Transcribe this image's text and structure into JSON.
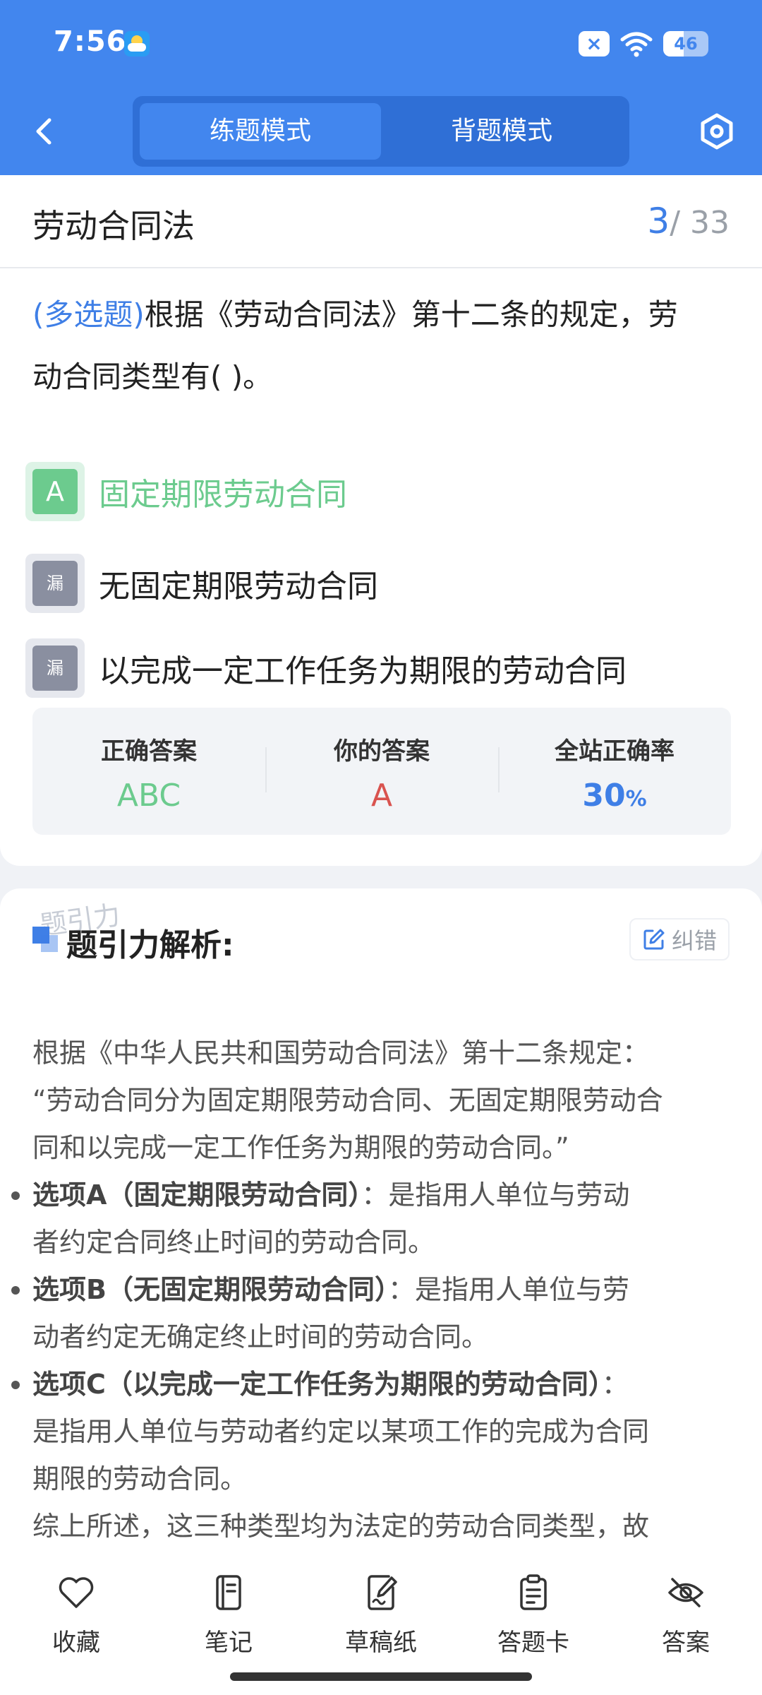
{
  "status_bar": {
    "time": "7:56",
    "battery": "46"
  },
  "nav": {
    "tabs": [
      {
        "label": "练题模式"
      },
      {
        "label": "背题模式"
      }
    ]
  },
  "question": {
    "title": "劳动合同法",
    "current": "3",
    "total": "/ 33",
    "type": "(多选题)",
    "stem_line1": "根据《劳动合同法》第十二条的规定，劳",
    "stem_line2": "动合同类型有( )。",
    "options": [
      {
        "badge": "A",
        "text": "固定期限劳动合同",
        "state": "correct"
      },
      {
        "badge": "漏",
        "text": "无固定期限劳动合同",
        "state": "missed"
      },
      {
        "badge": "漏",
        "text": "以完成一定工作任务为期限的劳动合同",
        "state": "missed"
      }
    ]
  },
  "stats": {
    "correct_label": "正确答案",
    "correct_value": "ABC",
    "yours_label": "你的答案",
    "yours_value": "A",
    "rate_label": "全站正确率",
    "rate_value": "30",
    "rate_unit": "%"
  },
  "analysis": {
    "watermark": "题引力",
    "title": "题引力解析:",
    "correct_button": "纠错",
    "intro_line1": "根据《中华人民共和国劳动合同法》第十二条规定：",
    "intro_line2": "“劳动合同分为固定期限劳动合同、无固定期限劳动合",
    "intro_line3": "同和以完成一定工作任务为期限的劳动合同。”",
    "items": [
      {
        "bold": "选项A（固定期限劳动合同）",
        "rest1": "：是指用人单位与劳动",
        "rest2": "者约定合同终止时间的劳动合同。"
      },
      {
        "bold": "选项B（无固定期限劳动合同）",
        "rest1": "：是指用人单位与劳",
        "rest2": "动者约定无确定终止时间的劳动合同。"
      },
      {
        "bold": "选项C（以完成一定工作任务为期限的劳动合同）",
        "rest1": "：",
        "rest2": "是指用人单位与劳动者约定以某项工作的完成为合同",
        "rest3": "期限的劳动合同。"
      }
    ],
    "summary": "综上所述，这三种类型均为法定的劳动合同类型，故"
  },
  "toolbar": [
    {
      "label": "收藏",
      "icon": "heart-icon"
    },
    {
      "label": "笔记",
      "icon": "notebook-icon"
    },
    {
      "label": "草稿纸",
      "icon": "draft-paper-icon"
    },
    {
      "label": "答题卡",
      "icon": "answer-sheet-icon"
    },
    {
      "label": "答案",
      "icon": "eye-off-icon"
    }
  ],
  "colors": {
    "header_blue": "#4286ee",
    "correct_green": "#6ccb8e",
    "wrong_red": "#d9534f",
    "accent_blue": "#3f7fe6"
  }
}
